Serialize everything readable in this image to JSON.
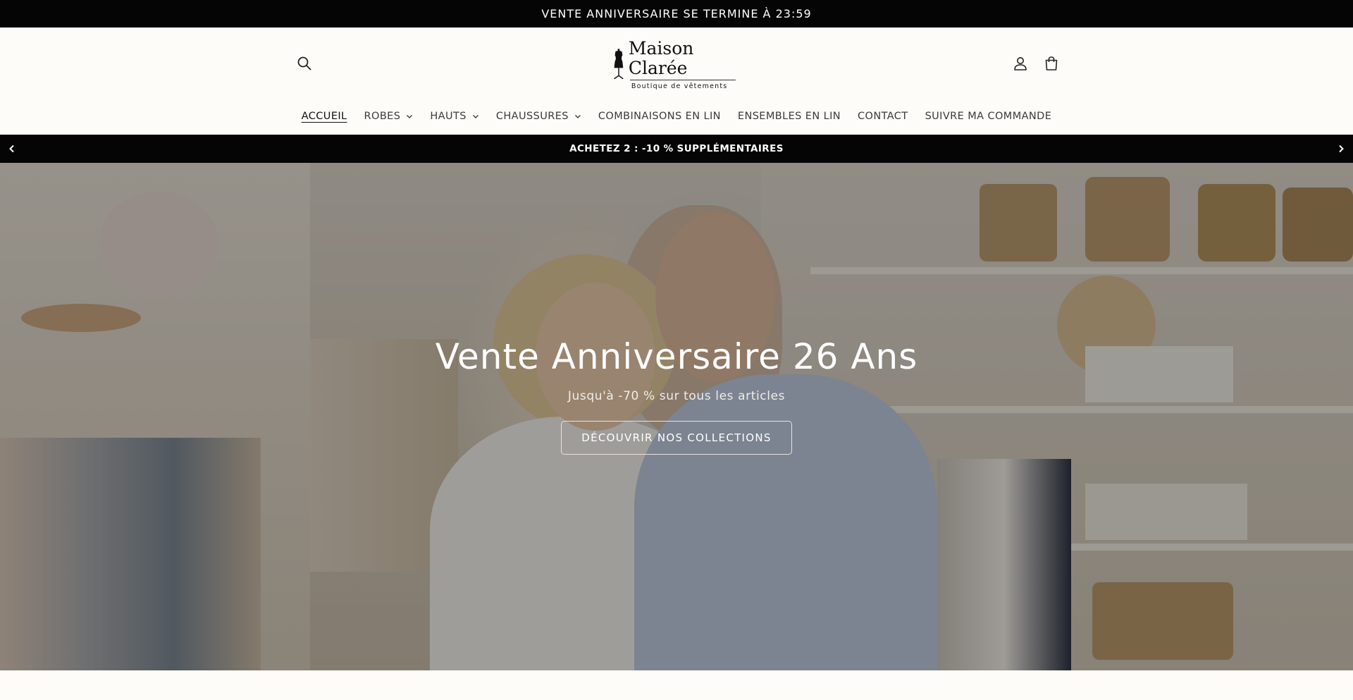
{
  "announcement": {
    "text": "VENTE ANNIVERSAIRE SE TERMINE À 23:59"
  },
  "header": {
    "brand_name": "Maison Clarée",
    "brand_tagline": "Boutique de vêtements",
    "search_icon": "search-icon",
    "account_icon": "user-icon",
    "cart_icon": "bag-icon"
  },
  "nav": {
    "items": [
      {
        "label": "ACCUEIL",
        "active": true,
        "dropdown": false
      },
      {
        "label": "ROBES",
        "dropdown": true
      },
      {
        "label": "HAUTS",
        "dropdown": true
      },
      {
        "label": "CHAUSSURES",
        "dropdown": true
      },
      {
        "label": "COMBINAISONS EN LIN",
        "dropdown": false
      },
      {
        "label": "ENSEMBLES EN LIN",
        "dropdown": false
      },
      {
        "label": "CONTACT",
        "dropdown": false
      },
      {
        "label": "SUIVRE MA COMMANDE",
        "dropdown": false
      }
    ]
  },
  "promo_bar": {
    "text": "ACHETEZ 2 : -10 % SUPPLÉMENTAIRES",
    "prev_icon": "chevron-left-icon",
    "next_icon": "chevron-right-icon"
  },
  "hero": {
    "title": "Vente Anniversaire 26 Ans",
    "subtitle": "Jusqu'à -70 % sur tous les articles",
    "cta_label": "DÉCOUVRIR NOS COLLECTIONS"
  },
  "colors": {
    "bar_background": "#050505",
    "page_background": "#fdfcf8",
    "text_dark": "#222222"
  }
}
